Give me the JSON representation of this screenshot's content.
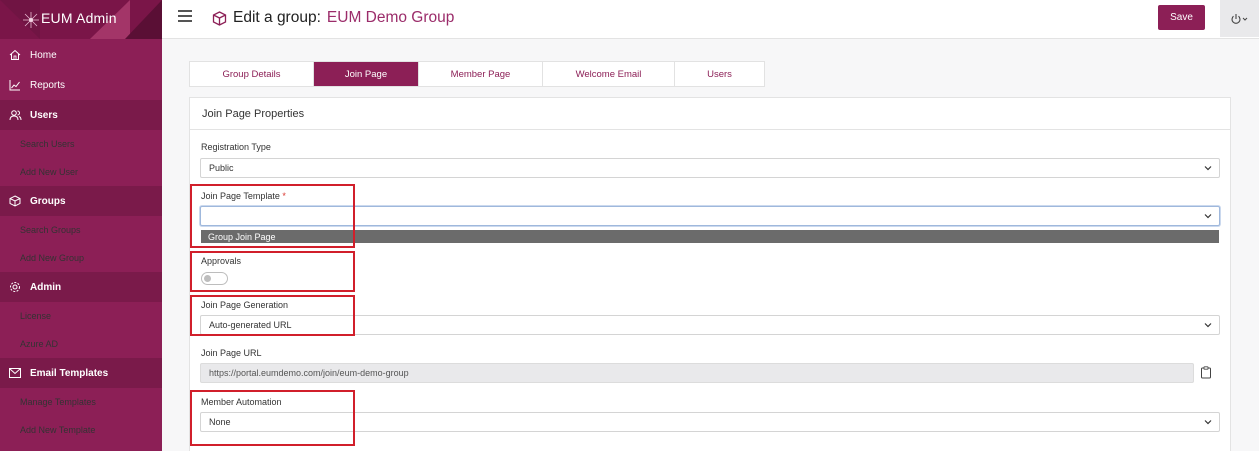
{
  "app": {
    "title": "EUM Admin"
  },
  "sidebar": {
    "home": "Home",
    "reports": "Reports",
    "users": "Users",
    "search_users": "Search Users",
    "add_new_user": "Add New User",
    "groups": "Groups",
    "search_groups": "Search Groups",
    "add_new_group": "Add New Group",
    "admin": "Admin",
    "license": "License",
    "azure_ad": "Azure AD",
    "email_templates": "Email Templates",
    "manage_templates": "Manage Templates",
    "add_new_template": "Add New Template"
  },
  "header": {
    "title_label": "Edit a group:",
    "group_name": "EUM Demo Group",
    "save_label": "Save"
  },
  "tabs": [
    "Group Details",
    "Join Page",
    "Member Page",
    "Welcome Email",
    "Users"
  ],
  "active_tab": "Join Page",
  "panel": {
    "title": "Join Page Properties",
    "registration_type_label": "Registration Type",
    "registration_type_value": "Public",
    "join_template_label": "Join Page Template",
    "required_mark": "*",
    "join_template_value": "",
    "join_template_option": "Group Join Page",
    "approvals_label": "Approvals",
    "approvals_on": false,
    "generation_label": "Join Page Generation",
    "generation_value": "Auto-generated URL",
    "url_label": "Join Page URL",
    "url_value": "https://portal.eumdemo.com/join/eum-demo-group",
    "automation_label": "Member Automation",
    "automation_value": "None"
  },
  "colors": {
    "brand": "#8c1f56",
    "highlight_box": "#d11f2b"
  },
  "icons": [
    "home-icon",
    "reports-icon",
    "users-icon",
    "groups-icon",
    "admin-icon",
    "email-icon",
    "hamburger-icon",
    "cube-icon",
    "power-icon",
    "chevron-down-icon",
    "clipboard-icon"
  ]
}
